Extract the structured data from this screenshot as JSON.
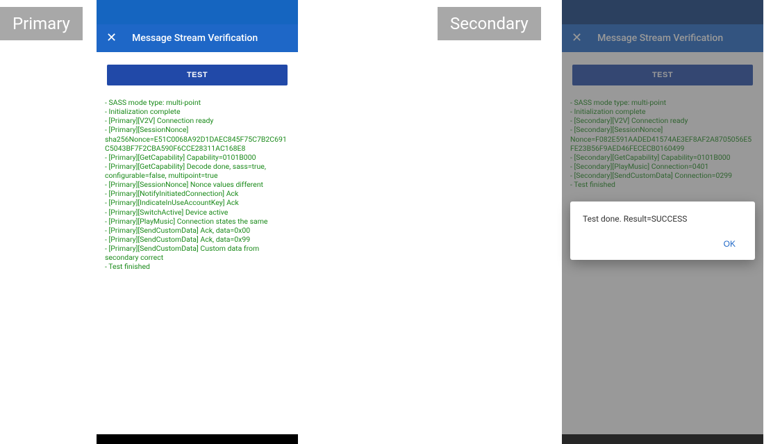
{
  "labels": {
    "primary": "Primary",
    "secondary": "Secondary"
  },
  "app_bar": {
    "title": "Message Stream Verification",
    "close_glyph": "✕"
  },
  "test_button_label": "TEST",
  "primary_log": [
    " - SASS mode type: multi-point",
    " - Initialization complete",
    " - [Primary][V2V] Connection ready",
    " - [Primary][SessionNonce] sha256Nonce=E51C0068A92D1DAEC845F75C7B2C691C5043BF7F2CBA590F6CCE28311AC168E8",
    " - [Primary][GetCapability] Capability=0101B000",
    " - [Primary][GetCapability] Decode done, sass=true, configurable=false, multipoint=true",
    " - [Primary][SessionNonce] Nonce values different",
    " - [Primary][NotifyInitiatedConnection] Ack",
    " - [Primary][IndicateInUseAccountKey] Ack",
    " - [Primary][SwitchActive] Device active",
    " - [Primary][PlayMusic] Connection states the same",
    " - [Primary][SendCustomData] Ack, data=0x00",
    " - [Primary][SendCustomData] Ack, data=0x99",
    " - [Primary][SendCustomData] Custom data from secondary correct",
    " - Test finished"
  ],
  "secondary_log": [
    " - SASS mode type: multi-point",
    " - Initialization complete",
    " - [Secondary][V2V] Connection ready",
    " - [Secondary][SessionNonce] Nonce=F082E591AADED41574AE3EF8AF2A8705056E5FE23B56F9AED46FECECB0160499",
    " - [Secondary][GetCapability] Capability=0101B000",
    " - [Secondary][PlayMusic] Connection=0401",
    " - [Secondary][SendCustomData] Connection=0299",
    " - Test finished"
  ],
  "dialog": {
    "message": "Test done. Result=SUCCESS",
    "ok_label": "OK"
  }
}
